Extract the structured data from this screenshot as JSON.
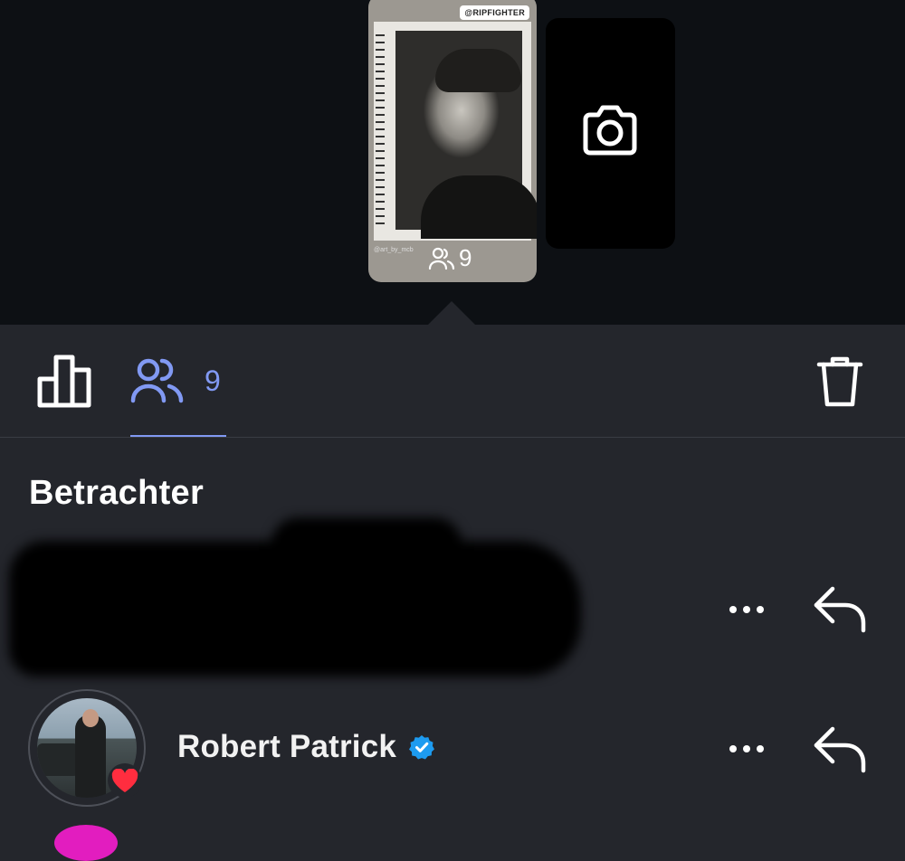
{
  "story": {
    "card_handle": "@RIPFIGHTER",
    "watermark": "@art_by_mcb",
    "viewer_count": "9"
  },
  "tabs": {
    "viewers_count": "9"
  },
  "section": {
    "title": "Betrachter"
  },
  "viewers": [
    {
      "name": "[redacted]",
      "redacted": true
    },
    {
      "name": "Robert Patrick",
      "verified": true,
      "liked": true
    }
  ],
  "colors": {
    "accent": "#8199f3",
    "verified": "#1d9bf0",
    "heart": "#ff2d3f",
    "background": "#24262c",
    "top_background": "#0d1014"
  },
  "icons": [
    "stats-icon",
    "viewers-icon",
    "trash-icon",
    "camera-icon",
    "more-icon",
    "reply-icon",
    "verified-icon",
    "heart-icon"
  ]
}
